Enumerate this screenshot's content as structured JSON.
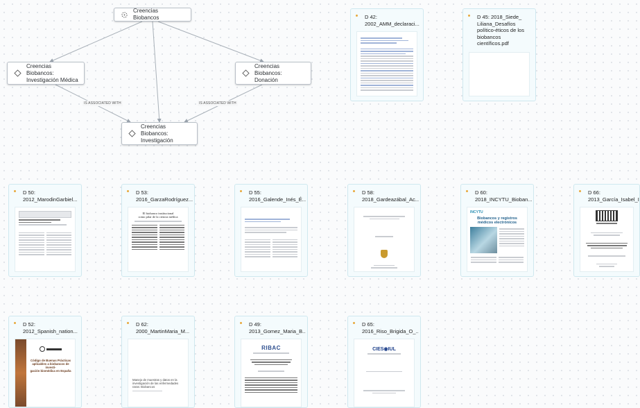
{
  "graph": {
    "nodes": [
      {
        "id": "root",
        "label": "Creencias Biobancos",
        "icon": "crosshair-icon"
      },
      {
        "id": "med",
        "label": "Creencias Biobancos:\nInvestigación Médica",
        "icon": "diamond-icon"
      },
      {
        "id": "don",
        "label": "Creencias Biobancos:\nDonación",
        "icon": "diamond-icon"
      },
      {
        "id": "inv",
        "label": "Creencias Biobancos:\nInvestigación",
        "icon": "diamond-icon"
      }
    ],
    "edge_labels": [
      "IS ASSOCIATED WITH",
      "IS ASSOCIATED WITH"
    ]
  },
  "documents": [
    {
      "title": "D 42:\n2002_AMM_declaraci...",
      "thumb": "text-blue"
    },
    {
      "title": "D 45: 2018_Siede_\nLiliana_Desafíos\npolítico-éticos de los\nbiobancos\ncientíficos.pdf",
      "thumb": "blank"
    },
    {
      "title": "D 50:\n2012_MarodinGarbiel...",
      "thumb": "journal"
    },
    {
      "title": "D 53:\n2016_GarzaRodríguez...",
      "thumb": "article",
      "thumb_heading": "El biobanco institucional\ncomo pilar de la ciencia médica"
    },
    {
      "title": "D 55:\n2016_Galende_Inés_É...",
      "thumb": "text"
    },
    {
      "title": "D 58:\n2018_Gardeazábal_Ac...",
      "thumb": "cover-crest"
    },
    {
      "title": "D 60:\n2018_INCYTU_Bioban...",
      "thumb": "incytu",
      "thumb_heading": "Biobancos y registros\nmédicos electrónicos"
    },
    {
      "title": "D 66:\n2013_García_Isabel_I...",
      "thumb": "thesis"
    },
    {
      "title": "D 52:\n2012_Spanish_nation...",
      "thumb": "code",
      "thumb_heading": "Código de Buenas Prácticas\naplicables a biobancos de investi-\ngación biomédica en España"
    },
    {
      "title": "D 62:\n2000_MartinMaria_M...",
      "thumb": "plain",
      "thumb_heading": "Manejo de muestras y datos en la\ninvestigación de las enfermedades\nraras: Biobancos"
    },
    {
      "title": "D 49:\n2013_Gomez_Maria_B...",
      "thumb": "ribac",
      "thumb_heading": "RIBAC"
    },
    {
      "title": "D 65:\n2016_Riso_Brigida_O_...",
      "thumb": "cies",
      "thumb_heading": "CIES◉IUL"
    }
  ],
  "colors": {
    "doc_bg": "#f4fbfd",
    "doc_border": "#cfe8ef",
    "dot": "#e8a93c",
    "edge": "#9aa3ad"
  }
}
